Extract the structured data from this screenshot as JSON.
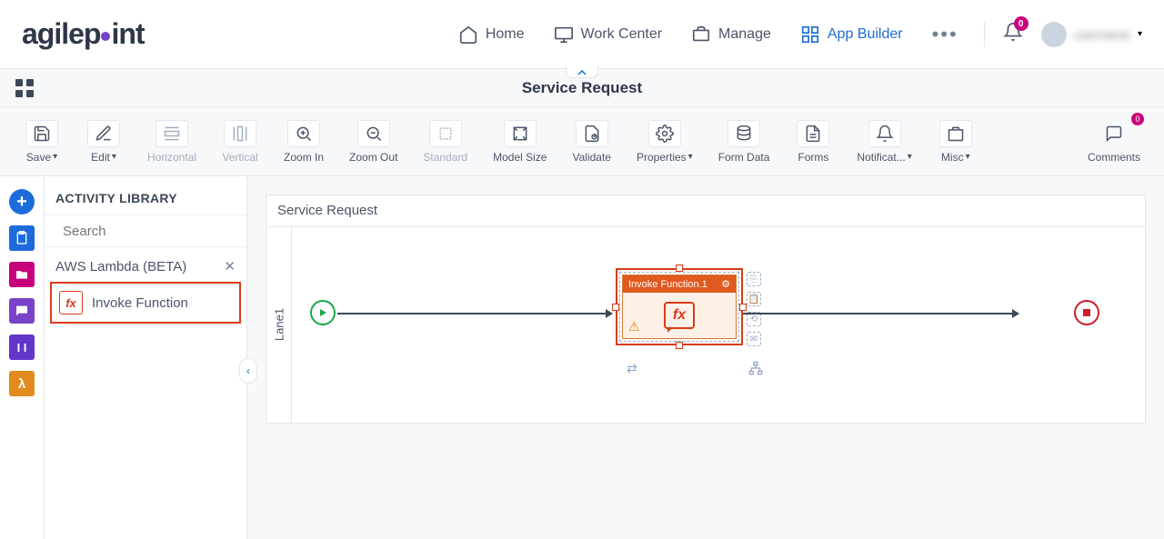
{
  "header": {
    "logo": "agilepoint",
    "nav": {
      "home": "Home",
      "work_center": "Work Center",
      "manage": "Manage",
      "app_builder": "App Builder"
    },
    "notifications": "0",
    "user_name": "username"
  },
  "subheader": {
    "title": "Service Request"
  },
  "toolbar": {
    "save": "Save",
    "edit": "Edit",
    "horizontal": "Horizontal",
    "vertical": "Vertical",
    "zoom_in": "Zoom In",
    "zoom_out": "Zoom Out",
    "standard": "Standard",
    "model_size": "Model Size",
    "validate": "Validate",
    "properties": "Properties",
    "form_data": "Form Data",
    "forms": "Forms",
    "notifications": "Notificat...",
    "misc": "Misc",
    "comments": "Comments",
    "comments_count": "0"
  },
  "sidebar": {
    "title": "ACTIVITY LIBRARY",
    "search_placeholder": "Search",
    "group": "AWS Lambda (BETA)",
    "item": "Invoke Function"
  },
  "canvas": {
    "title": "Service Request",
    "lane": "Lane1",
    "activity": {
      "title": "Invoke Function.1"
    }
  }
}
